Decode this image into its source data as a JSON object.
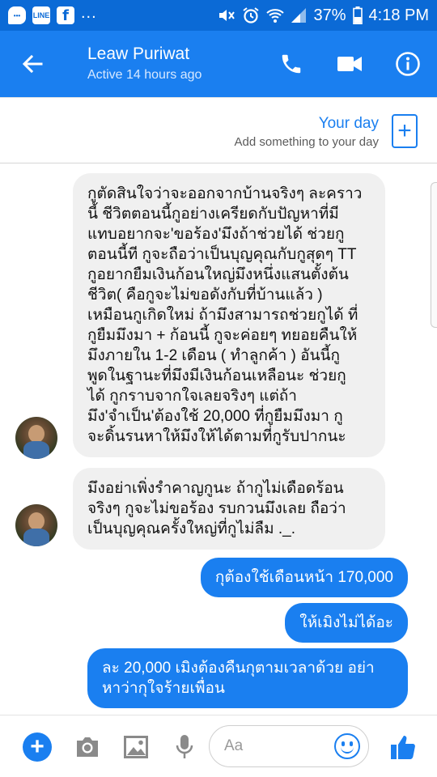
{
  "status_bar": {
    "left_icons": [
      "chat-app-icon",
      "line-icon",
      "facebook-icon"
    ],
    "line_label": "LINE",
    "facebook_label": "f",
    "overflow": "...",
    "battery": "37%",
    "time": "4:18 PM"
  },
  "header": {
    "contact_name": "Leaw Puriwat",
    "contact_status": "Active 14 hours ago",
    "icons": [
      "back-arrow-icon",
      "phone-icon",
      "video-camera-icon",
      "info-icon"
    ]
  },
  "your_day": {
    "title": "Your day",
    "subtitle": "Add something to your day",
    "add_symbol": "+"
  },
  "messages": [
    {
      "side": "in",
      "text": "กูตัดสินใจว่าจะออกจากบ้านจริงๆ ละคราว\nนี้ ชีวิตตอนนี้กูอย่างเครียดกับปัญหาที่มี\nแทบอยากจะ'ขอร้อง'มึงถ้าช่วยได้ ช่วยกู\nตอนนี้ที กูจะถือว่าเป็นบุญคุณกับกูสุดๆ TT\nกูอยากยืมเงินก้อนใหญ่มึงหนึ่งแสนตั้งต้น\nชีวิต( คือกูจะไม่ขอดังกับที่บ้านแล้ว )\nเหมือนกูเกิดใหม่ ถ้ามึงสามารถช่วยกูได้ ที่\nกูยืมมึงมา + ก้อนนี้ กูจะค่อยๆ ทยอยคืนให้\nมึงภายใน 1-2 เดือน ( ทำลูกค้า ) อันนี้กู\nพูดในฐานะที่มึงมีเงินก้อนเหลือนะ ช่วยกู\nได้ กูกราบจากใจเลยจริงๆ แต่ถ้า\nมึง'จำเป็น'ต้องใช้ 20,000 ที่กูยืมมึงมา  กู\nจะดิ้นรนหาให้มึงให้ได้ตามที่กูรับปากนะ"
    },
    {
      "side": "in",
      "text": "มึงอย่าเพิ่งรำคาญกูนะ ถ้ากูไม่เดือดร้อน\nจริงๆ กูจะไม่ขอร้อง รบกวนมึงเลย ถือว่า\nเป็นบุญคุณครั้งใหญ่ที่กูไม่ลืม ._."
    },
    {
      "side": "out",
      "text": "กุต้องใช้เดือนหน้า 170,000"
    },
    {
      "side": "out",
      "text": "ให้เมิงไม่ได้อะ"
    },
    {
      "side": "out",
      "text": "ละ 20,000 เมิงต้องคืนกุตามเวลาด้วย อย่า\nหาว่ากุใจร้ายเพื่อน"
    }
  ],
  "composer": {
    "placeholder": "Aa",
    "icons": [
      "plus-icon",
      "camera-icon",
      "image-icon",
      "microphone-icon",
      "emoji-icon",
      "thumbs-up-icon"
    ]
  },
  "colors": {
    "accent": "#1a7ff0",
    "status_bar": "#0b6ad6",
    "incoming_bubble": "#f0f0f0",
    "composer_icon_gray": "#8a8a8a"
  }
}
